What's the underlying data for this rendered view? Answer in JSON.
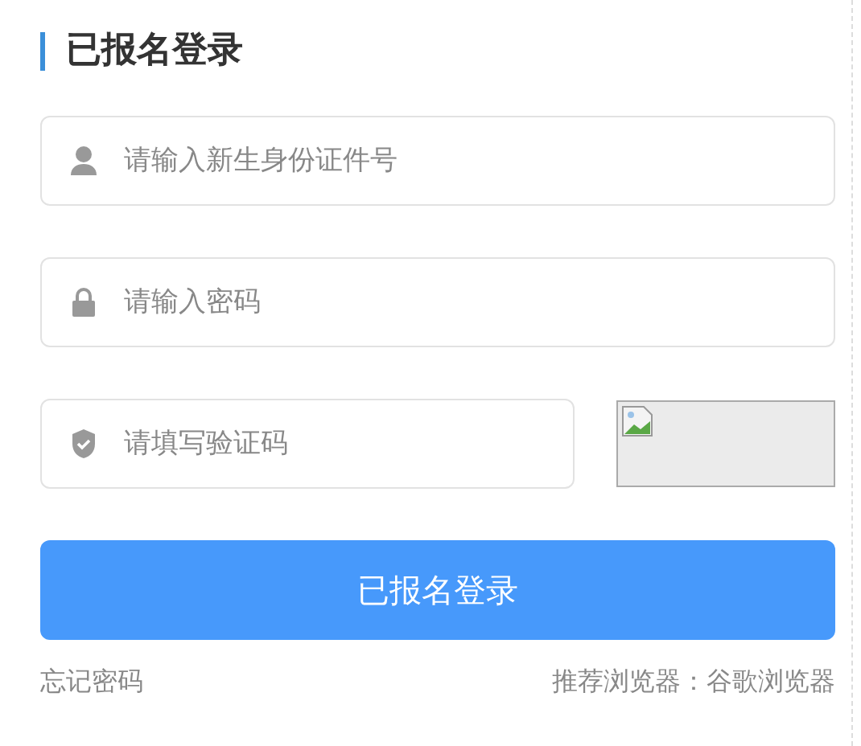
{
  "title": "已报名登录",
  "fields": [
    {
      "kind": "user",
      "placeholder": "请输入新生身份证件号"
    },
    {
      "kind": "password",
      "placeholder": "请输入密码"
    },
    {
      "kind": "captcha",
      "placeholder": "请填写验证码"
    }
  ],
  "submit": "已报名登录",
  "footer": {
    "forgot": "忘记密码",
    "browser_hint": "推荐浏览器：谷歌浏览器"
  }
}
